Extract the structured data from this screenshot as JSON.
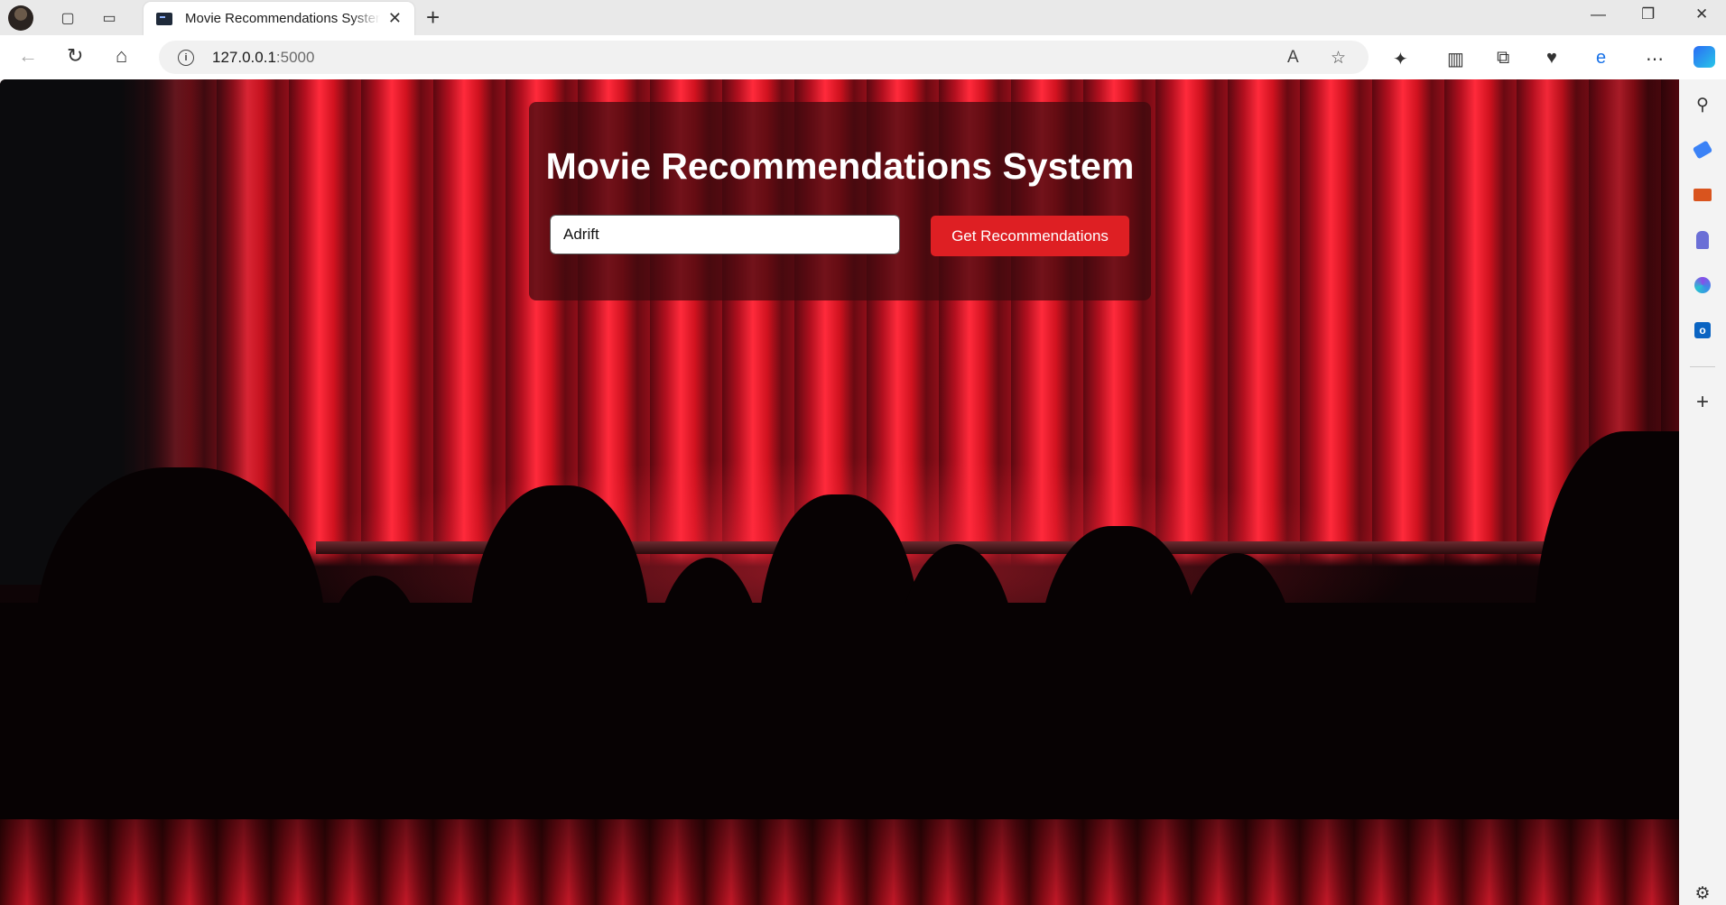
{
  "browser": {
    "tab_title": "Movie Recommendations System",
    "tab_close": "✕",
    "new_tab": "+",
    "url_host": "127.0.0.1",
    "url_port": ":5000",
    "window_controls": {
      "minimize": "—",
      "restore": "❐",
      "close": "✕"
    },
    "nav": {
      "back": "←",
      "reload": "↻",
      "home": "⌂"
    },
    "omnibox_icons": {
      "read_aloud": "A",
      "favorite": "☆"
    },
    "toolbar_icons": {
      "extensions": "✦",
      "split": "▥",
      "collections": "⧉",
      "performance": "♥",
      "copilot": "e",
      "more": "⋯"
    }
  },
  "page": {
    "heading": "Movie Recommendations System",
    "search_value": "Adrift",
    "button_label": "Get Recommendations"
  },
  "sidebar": {
    "icons": [
      "search-icon",
      "tag-icon",
      "briefcase-icon",
      "chess-icon",
      "m365-icon",
      "outlook-icon",
      "add-icon",
      "settings-icon"
    ],
    "search": "⚲",
    "add": "+",
    "settings": "⚙"
  },
  "colors": {
    "button": "#de1f23",
    "panel": "rgba(60,10,14,0.72)",
    "curtain": "#b3101f"
  }
}
